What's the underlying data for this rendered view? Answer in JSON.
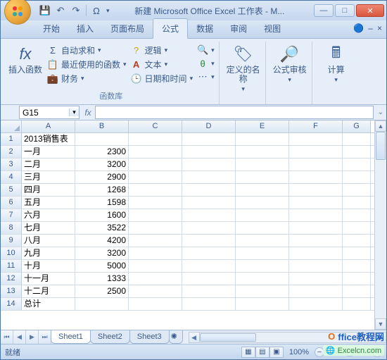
{
  "window": {
    "title": "新建 Microsoft Office Excel 工作表 - M..."
  },
  "qat": {
    "save": "💾",
    "undo": "↶",
    "redo": "↷",
    "omega": "Ω"
  },
  "tabs": {
    "items": [
      "开始",
      "插入",
      "页面布局",
      "公式",
      "数据",
      "审阅",
      "视图"
    ],
    "active_index": 3,
    "help": "?",
    "min": "–",
    "close": "×"
  },
  "ribbon": {
    "group1": {
      "big_label": "插入函数",
      "big_icon": "fx",
      "autosum_icon": "Σ",
      "autosum": "自动求和",
      "recent_icon": "📋",
      "recent": "最近使用的函数",
      "financial_icon": "💼",
      "financial": "财务",
      "logical_icon": "?",
      "logical": "逻辑",
      "text_icon": "A",
      "text": "文本",
      "datetime_icon": "🕒",
      "datetime": "日期和时间",
      "lookup": "🔍",
      "math": "θ",
      "more": "⋯",
      "label": "函数库"
    },
    "group2": {
      "icon": "🏷",
      "label": "定义的名称"
    },
    "group3": {
      "icon": "🔎",
      "label": "公式审核"
    },
    "group4": {
      "icon": "🖩",
      "label": "计算"
    }
  },
  "namebox": {
    "value": "G15"
  },
  "formulabar": {
    "fx": "fx",
    "value": ""
  },
  "columns": [
    "A",
    "B",
    "C",
    "D",
    "E",
    "F",
    "G"
  ],
  "col_widths": [
    "col-A",
    "col-B",
    "col-C",
    "col-D",
    "col-E",
    "col-F",
    "col-G"
  ],
  "rows": [
    {
      "n": 1,
      "cells": [
        "         2013销售表",
        "",
        "",
        "",
        "",
        "",
        ""
      ]
    },
    {
      "n": 2,
      "cells": [
        "一月",
        "2300",
        "",
        "",
        "",
        "",
        ""
      ]
    },
    {
      "n": 3,
      "cells": [
        "二月",
        "3200",
        "",
        "",
        "",
        "",
        ""
      ]
    },
    {
      "n": 4,
      "cells": [
        "三月",
        "2900",
        "",
        "",
        "",
        "",
        ""
      ]
    },
    {
      "n": 5,
      "cells": [
        "四月",
        "1268",
        "",
        "",
        "",
        "",
        ""
      ]
    },
    {
      "n": 6,
      "cells": [
        "五月",
        "1598",
        "",
        "",
        "",
        "",
        ""
      ]
    },
    {
      "n": 7,
      "cells": [
        "六月",
        "1600",
        "",
        "",
        "",
        "",
        ""
      ]
    },
    {
      "n": 8,
      "cells": [
        "七月",
        "3522",
        "",
        "",
        "",
        "",
        ""
      ]
    },
    {
      "n": 9,
      "cells": [
        "八月",
        "4200",
        "",
        "",
        "",
        "",
        ""
      ]
    },
    {
      "n": 10,
      "cells": [
        "九月",
        "3200",
        "",
        "",
        "",
        "",
        ""
      ]
    },
    {
      "n": 11,
      "cells": [
        "十月",
        "5000",
        "",
        "",
        "",
        "",
        ""
      ]
    },
    {
      "n": 12,
      "cells": [
        "十一月",
        "1333",
        "",
        "",
        "",
        "",
        ""
      ]
    },
    {
      "n": 13,
      "cells": [
        "十二月",
        "2500",
        "",
        "",
        "",
        "",
        ""
      ]
    },
    {
      "n": 14,
      "cells": [
        "总计",
        "",
        "",
        "",
        "",
        "",
        ""
      ]
    }
  ],
  "sheets": {
    "items": [
      "Sheet1",
      "Sheet2",
      "Sheet3"
    ],
    "active_index": 0
  },
  "status": {
    "ready": "就绪",
    "zoom": "100%"
  },
  "watermark1": {
    "prefix": "O",
    "text": "ffice教程网"
  },
  "watermark2": "🌐 Excelcn.com"
}
